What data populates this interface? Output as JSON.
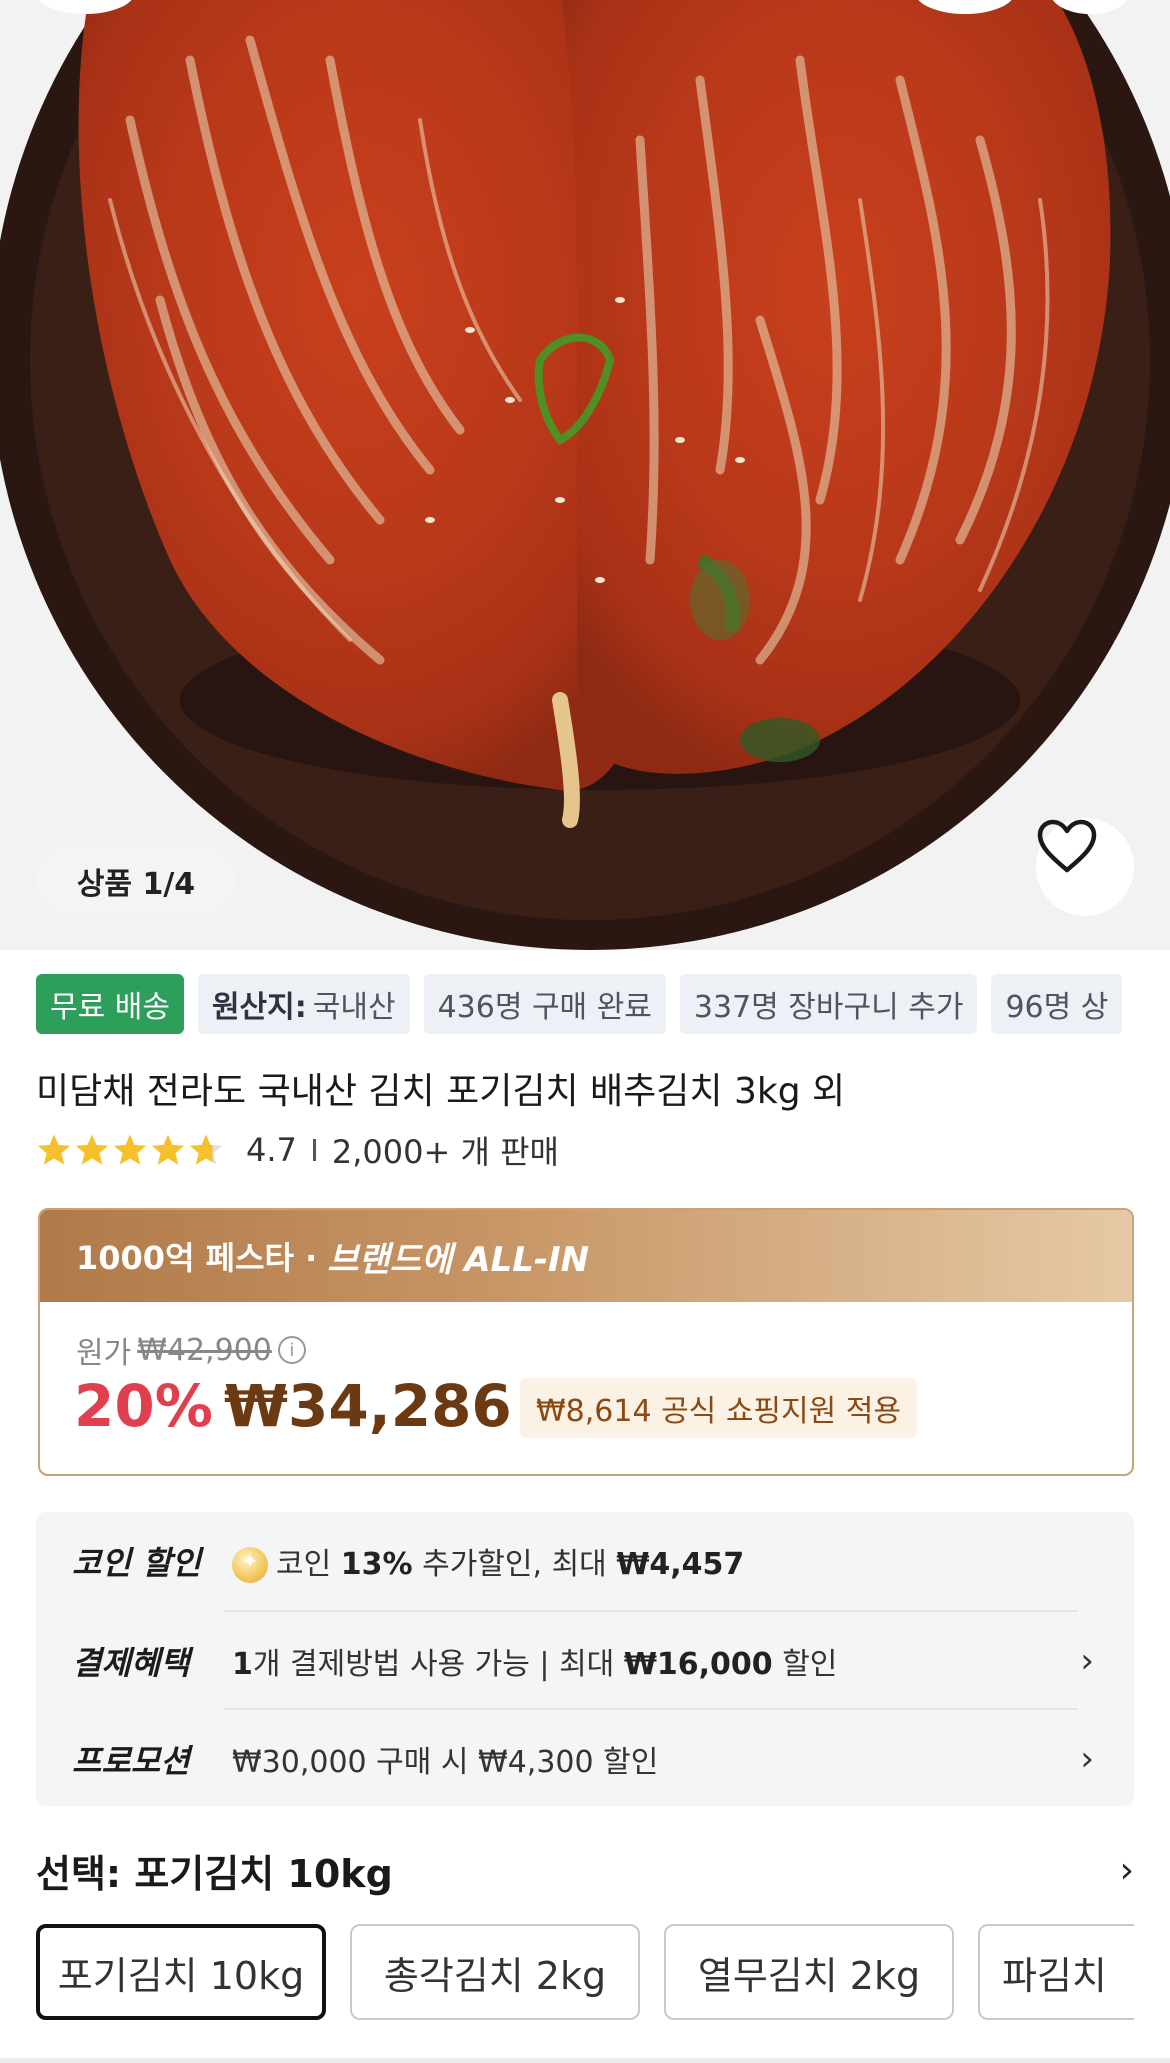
{
  "gallery": {
    "counter": "상품 1/4",
    "favorite_icon": "heart-outline-icon"
  },
  "tags": [
    {
      "text": "무료 배송"
    },
    {
      "label": "원산지:",
      "text": "국내산"
    },
    {
      "text": "436명 구매 완료"
    },
    {
      "text": "337명 장바구니 추가"
    },
    {
      "text": "96명 상"
    }
  ],
  "product": {
    "title": "미담채 전라도 국내산 김치 포기김치 배추김치 3kg 외",
    "rating": "4.7",
    "stars": 4.7,
    "sold": "2,000+ 개 판매"
  },
  "price_card": {
    "banner_festa": "1000억 페스타 · ",
    "banner_brand": "브랜드에 ALL-IN",
    "original_label": "원가",
    "original_price": "₩42,900",
    "discount": "20%",
    "price": "₩34,286",
    "support": "₩8,614 공식 쇼핑지원 적용"
  },
  "benefits": {
    "coin": {
      "label": "코인 할인",
      "prefix": "코인 ",
      "rate": "13%",
      "mid": " 추가할인, 최대 ",
      "max": "₩4,457"
    },
    "payment": {
      "label": "결제혜택",
      "count": "1",
      "mid": "개 결제방법 사용 가능 | 최대 ",
      "amount": "₩16,000",
      "suffix": " 할인"
    },
    "promotion": {
      "label": "프로모션",
      "text": "₩30,000 구매 시 ₩4,300 할인"
    }
  },
  "selection": {
    "label": "선택: 포기김치 10kg",
    "options": [
      "포기김치 10kg",
      "총각김치 2kg",
      "열무김치 2kg",
      "파김치"
    ]
  },
  "colors": {
    "free_shipping": "#2e9e5b",
    "discount_red": "#e0404e",
    "price_brown": "#6b3a12",
    "star_yellow": "#f6c02b"
  }
}
